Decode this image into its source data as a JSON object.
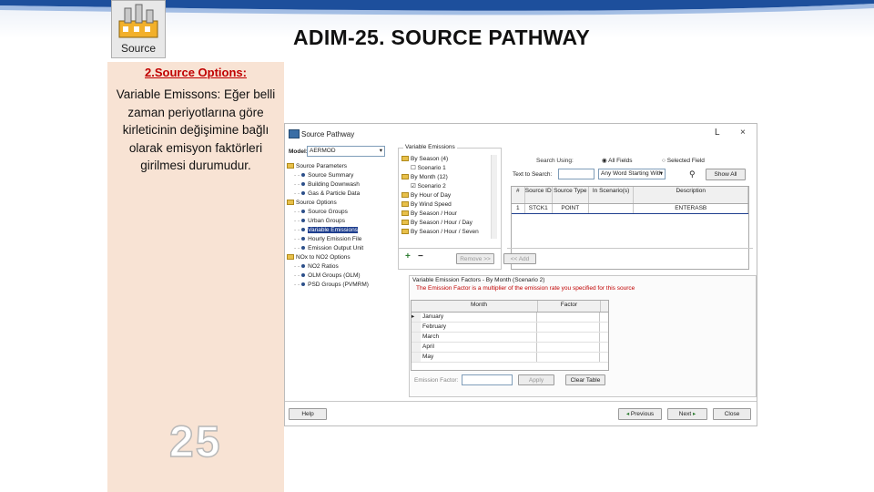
{
  "slide": {
    "title": "ADIM-25. SOURCE PATHWAY",
    "logo_label": "Source",
    "page_number": "25",
    "left_heading": "2.Source Options:",
    "left_text": "Variable Emissons: Eğer belli zaman periyotlarına göre kirleticinin değişimine bağlı olarak emisyon faktörleri girilmesi durumudur."
  },
  "dialog": {
    "title": "Source Pathway",
    "minimize": "L",
    "close": "×",
    "model_label": "Model:",
    "model_value": "AERMOD",
    "tree": [
      {
        "label": "Source Parameters",
        "kind": "folder",
        "level": 0
      },
      {
        "label": "Source Summary",
        "kind": "item",
        "level": 1
      },
      {
        "label": "Building Downwash",
        "kind": "item",
        "level": 1
      },
      {
        "label": "Gas & Particle Data",
        "kind": "item",
        "level": 1
      },
      {
        "label": "Source Options",
        "kind": "folder",
        "level": 0
      },
      {
        "label": "Source Groups",
        "kind": "item",
        "level": 1
      },
      {
        "label": "Urban Groups",
        "kind": "item",
        "level": 1
      },
      {
        "label": "Variable Emissions",
        "kind": "item",
        "level": 1,
        "selected": true
      },
      {
        "label": "Hourly Emission File",
        "kind": "item",
        "level": 1
      },
      {
        "label": "Emission Output Unit",
        "kind": "item",
        "level": 1
      },
      {
        "label": "NOx to NO2 Options",
        "kind": "folder",
        "level": 0
      },
      {
        "label": "NO2 Ratios",
        "kind": "item",
        "level": 1
      },
      {
        "label": "OLM Groups (OLM)",
        "kind": "item",
        "level": 1
      },
      {
        "label": "PSD Groups (PVMRM)",
        "kind": "item",
        "level": 1
      }
    ],
    "ve_group_title": "Variable Emissions",
    "ve_tree": [
      {
        "label": "By Season (4)",
        "kind": "folder"
      },
      {
        "label": "Scenario 1",
        "kind": "check",
        "checked": false
      },
      {
        "label": "By Month (12)",
        "kind": "folder"
      },
      {
        "label": "Scenario 2",
        "kind": "check",
        "checked": true
      },
      {
        "label": "By Hour of Day",
        "kind": "folder"
      },
      {
        "label": "By Wind Speed",
        "kind": "folder"
      },
      {
        "label": "By Season / Hour",
        "kind": "folder"
      },
      {
        "label": "By Season / Hour / Day",
        "kind": "folder"
      },
      {
        "label": "By Season / Hour / Seven",
        "kind": "folder"
      }
    ],
    "add_symbol": "+",
    "remove_symbol": "−",
    "remove_label": "Remove >>",
    "add_label": "<< Add",
    "search_using_label": "Search Using:",
    "all_fields_label": "All Fields",
    "selected_field_label": "Selected Field",
    "text_to_search_label": "Text to Search:",
    "match_mode": "Any Word Starting With",
    "show_all_label": "Show All",
    "grid_columns": [
      "#",
      "Source ID",
      "Source Type",
      "In Scenario(s)",
      "Description"
    ],
    "grid_rows": [
      {
        "num": "1",
        "id": "STCK1",
        "type": "POINT",
        "scenario": "",
        "desc": "ENTERASB"
      }
    ],
    "factors_title": "Variable Emission Factors - By Month (Scenario 2)",
    "factors_note": "The Emission Factor is a multiplier of the emission rate you specified for this source",
    "factors_columns": [
      "Month",
      "Factor"
    ],
    "factors_rows": [
      "January",
      "February",
      "March",
      "April",
      "May"
    ],
    "emission_factor_label": "Emission Factor:",
    "apply_label": "Apply",
    "clear_table_label": "Clear Table",
    "help_label": "Help",
    "previous_label": "Previous",
    "next_label": "Next",
    "close_label": "Close"
  }
}
